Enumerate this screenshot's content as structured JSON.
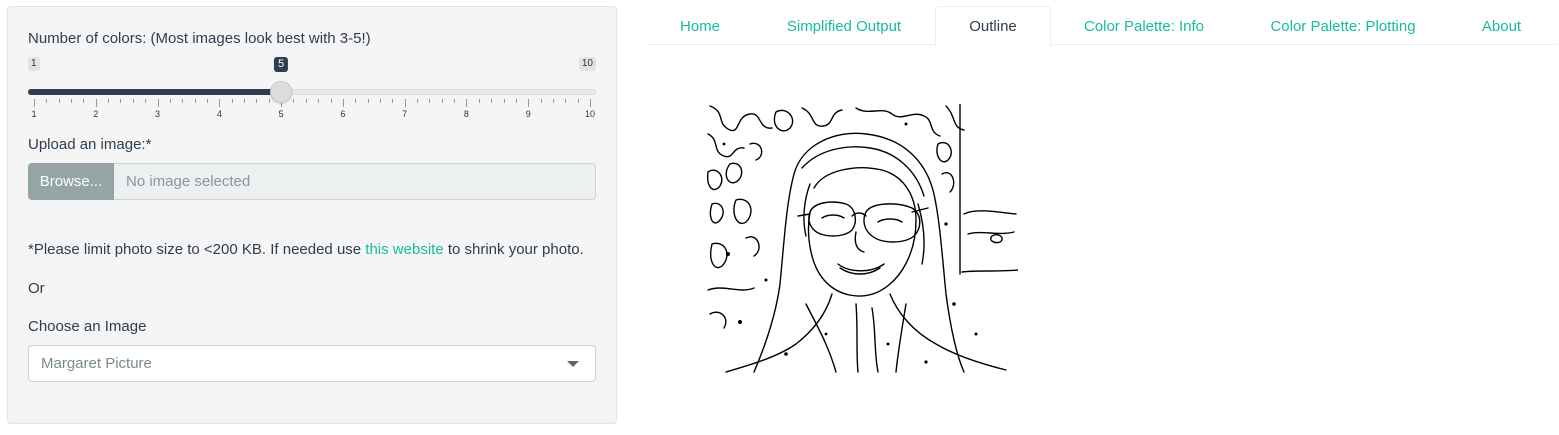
{
  "sidebar": {
    "slider": {
      "label": "Number of colors: (Most images look best with 3-5!)",
      "min": 1,
      "max": 10,
      "value": 5,
      "min_label": "1",
      "max_label": "10",
      "value_label": "5",
      "ticks": [
        "1",
        "2",
        "3",
        "4",
        "5",
        "6",
        "7",
        "8",
        "9",
        "10"
      ],
      "fill_color": "#2c3e50"
    },
    "upload": {
      "label": "Upload an image:*",
      "button_label": "Browse...",
      "placeholder": "No image selected"
    },
    "note": {
      "prefix": "*Please limit photo size to <200 KB. If needed use ",
      "link_text": "this website",
      "suffix": " to shrink your photo."
    },
    "or_text": "Or",
    "choose": {
      "label": "Choose an Image",
      "selected": "Margaret Picture"
    }
  },
  "tabs": [
    {
      "label": "Home",
      "active": false
    },
    {
      "label": "Simplified Output",
      "active": false
    },
    {
      "label": "Outline",
      "active": true
    },
    {
      "label": "Color Palette: Info",
      "active": false
    },
    {
      "label": "Color Palette: Plotting",
      "active": false
    },
    {
      "label": "About",
      "active": false
    }
  ],
  "colors": {
    "accent": "#18bc9c",
    "primary": "#2c3e50",
    "browse_button": "#95a5a6"
  },
  "icons": {
    "select_caret": "chevron-down-icon"
  }
}
